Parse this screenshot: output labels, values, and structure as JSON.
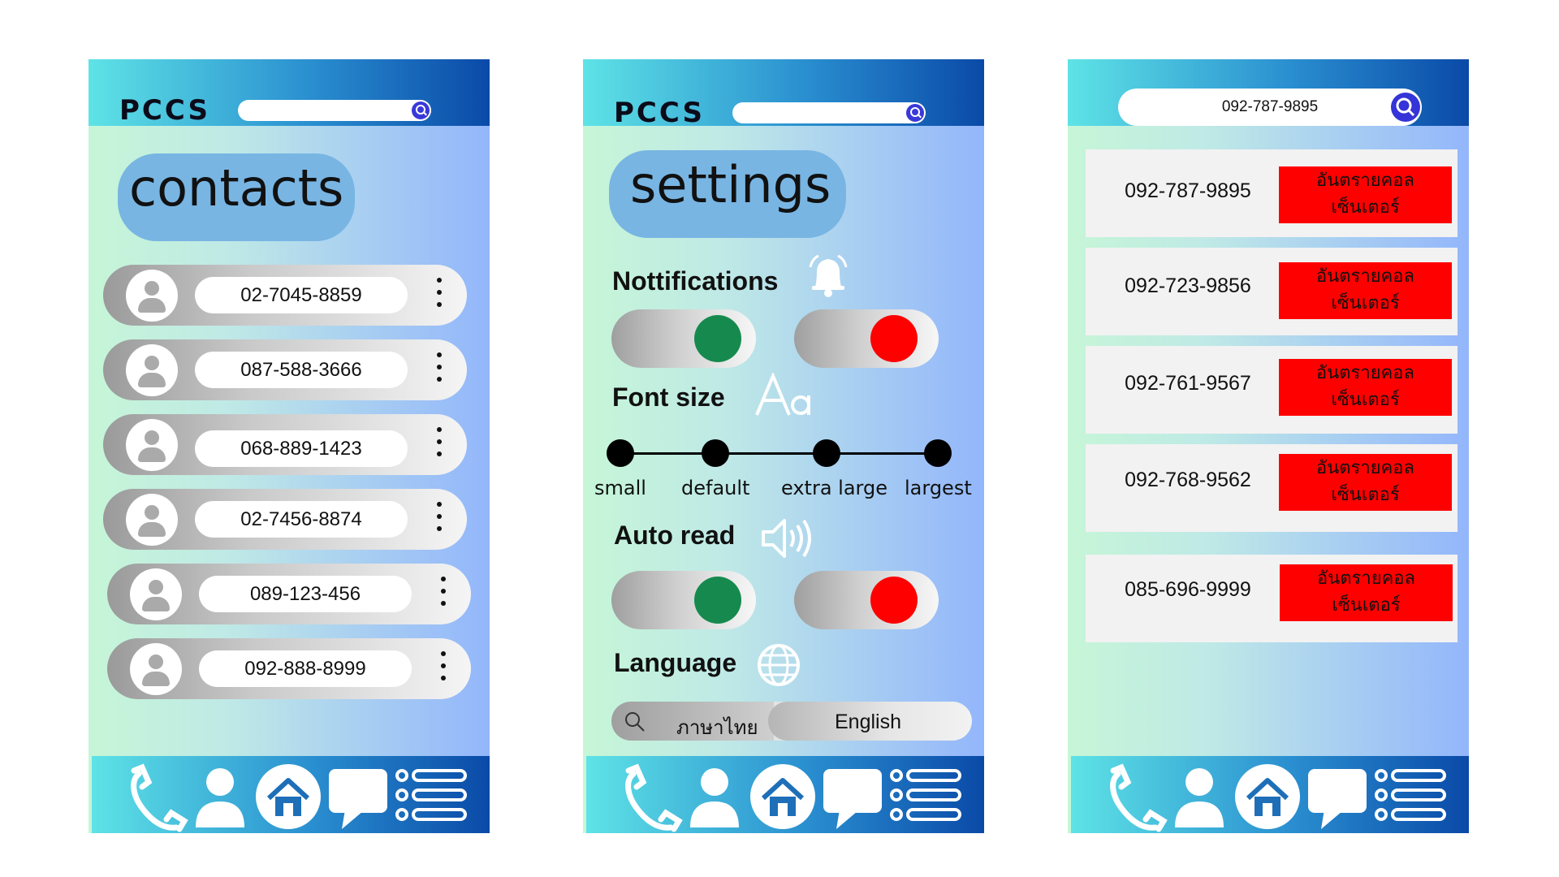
{
  "app": {
    "logo": "PCCS"
  },
  "contacts_screen": {
    "title": "contacts",
    "contacts": [
      {
        "number": "02-7045-8859"
      },
      {
        "number": "087-588-3666"
      },
      {
        "number": "068-889-1423"
      },
      {
        "number": "02-7456-8874"
      },
      {
        "number": "089-123-456"
      },
      {
        "number": "092-888-8999"
      }
    ]
  },
  "settings_screen": {
    "title": "settings",
    "notifications": {
      "label": "Nottifications"
    },
    "font_size": {
      "label": "Font size",
      "options": [
        "small",
        "default",
        "extra large",
        "largest"
      ]
    },
    "auto_read": {
      "label": "Auto read"
    },
    "language": {
      "label": "Language",
      "options": [
        "ภาษาไทย",
        "English"
      ],
      "selected": "English"
    },
    "toggle_on_color": "#168a4e",
    "toggle_off_color": "#ff0000"
  },
  "search_screen": {
    "query": "092-787-9895",
    "results": [
      {
        "number": "092-787-9895",
        "tag": "อันตรายคอลเซ็นเตอร์",
        "tag_line1": "อันตรายคอล",
        "tag_line2": "เซ็นเตอร์"
      },
      {
        "number": "092-723-9856",
        "tag": "อันตรายคอลเซ็นเตอร์",
        "tag_line1": "อันตรายคอล",
        "tag_line2": "เซ็นเตอร์"
      },
      {
        "number": "092-761-9567",
        "tag": "อันตรายคอลเซ็นเตอร์",
        "tag_line1": "อันตรายคอล",
        "tag_line2": "เซ็นเตอร์"
      },
      {
        "number": "092-768-9562",
        "tag": "อันตรายคอลเซ็นเตอร์",
        "tag_line1": "อันตรายคอล",
        "tag_line2": "เซ็นเตอร์"
      },
      {
        "number": "085-696-9999",
        "tag": "อันตรายคอลเซ็นเตอร์",
        "tag_line1": "อันตรายคอล",
        "tag_line2": "เซ็นเตอร์"
      }
    ],
    "danger_color": "#ff0000"
  },
  "bottom_nav": {
    "icons": [
      "phone-icon",
      "profile-icon",
      "home-icon",
      "chat-icon",
      "menu-list-icon"
    ]
  }
}
